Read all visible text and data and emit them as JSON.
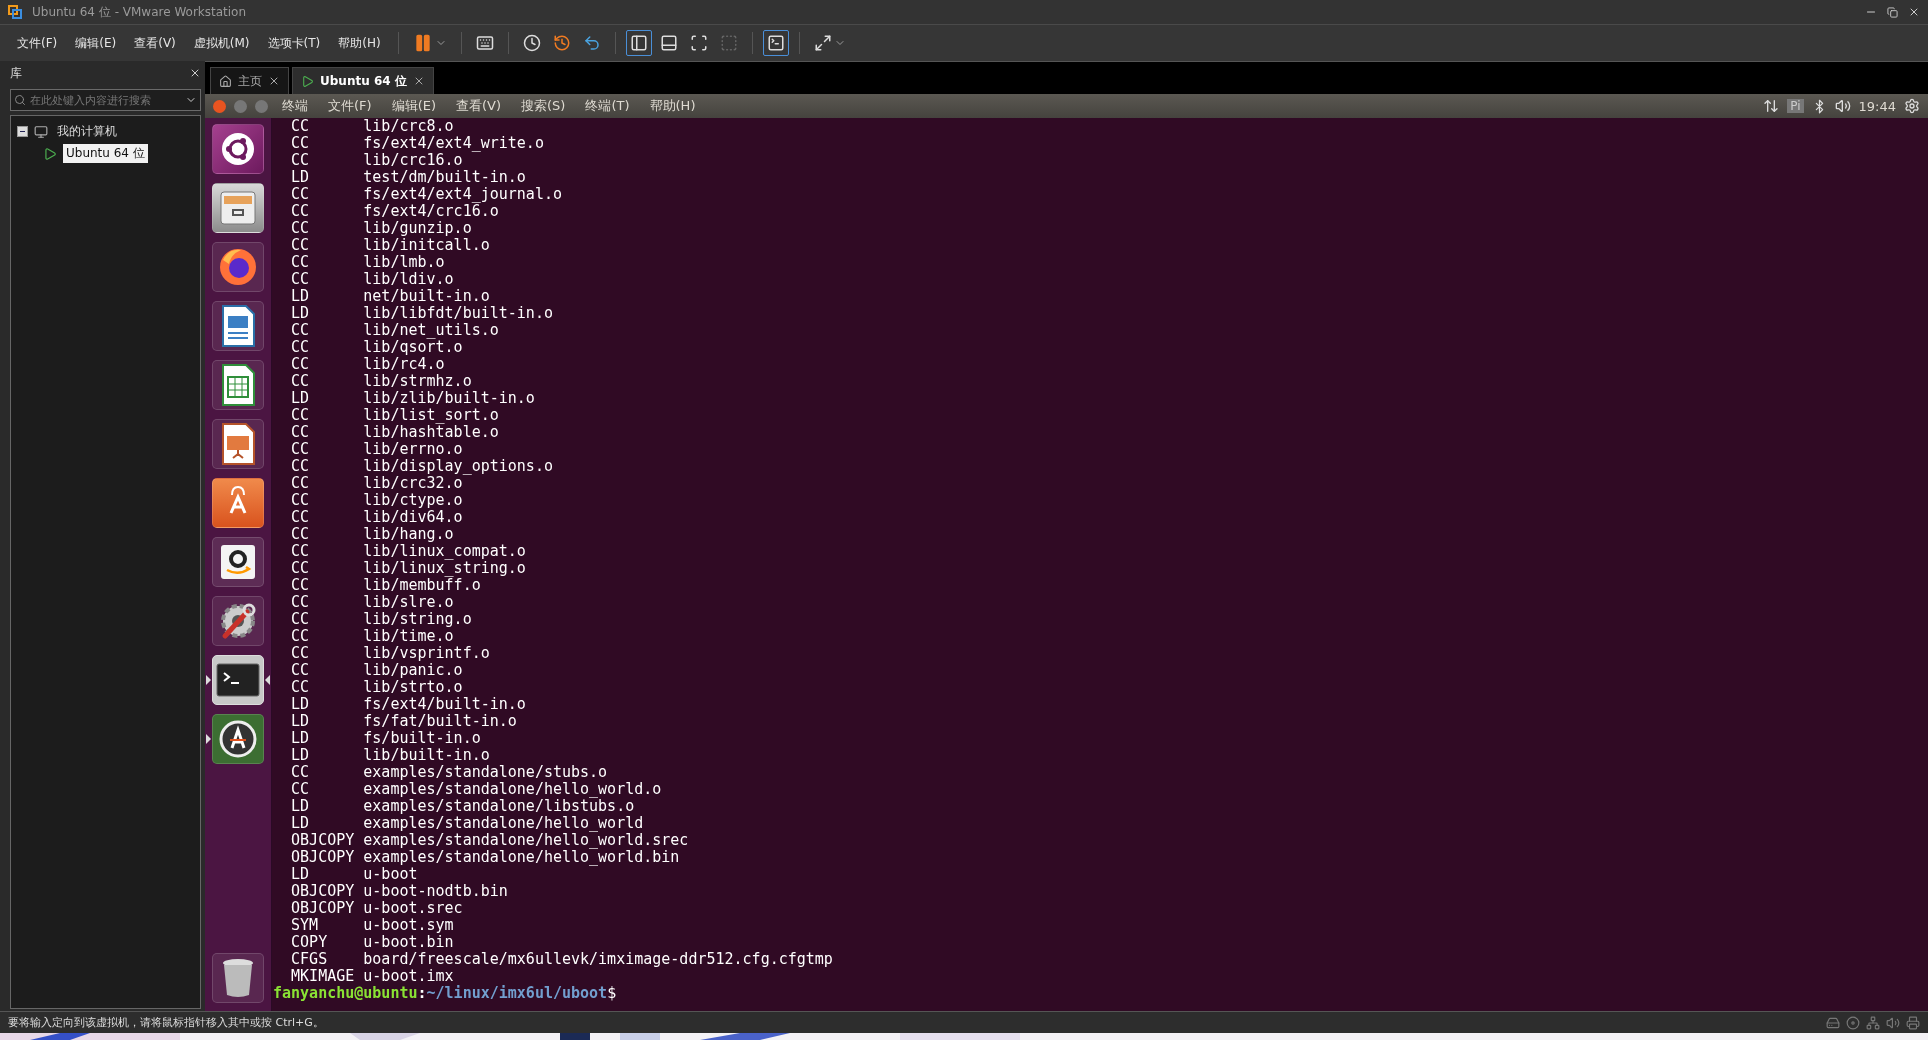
{
  "window": {
    "title": "Ubuntu 64 位 - VMware Workstation"
  },
  "menu": [
    "文件(F)",
    "编辑(E)",
    "查看(V)",
    "虚拟机(M)",
    "选项卡(T)",
    "帮助(H)"
  ],
  "library": {
    "title": "库",
    "search": {
      "placeholder": "在此处键入内容进行搜索"
    },
    "tree": [
      {
        "label": "我的计算机",
        "expanded": true,
        "children": [
          {
            "label": "Ubuntu 64 位",
            "selected": true
          }
        ]
      }
    ]
  },
  "tabs": [
    {
      "label": "主页",
      "kind": "home",
      "selected": false
    },
    {
      "label": "Ubuntu 64 位",
      "kind": "vm",
      "selected": true
    }
  ],
  "guest": {
    "menu": [
      "终端",
      "文件(F)",
      "编辑(E)",
      "查看(V)",
      "搜索(S)",
      "终端(T)",
      "帮助(H)"
    ],
    "keyboard": "Pi",
    "clock": "19:44",
    "launcher": [
      {
        "kind": "dash",
        "running": false,
        "focused": false
      },
      {
        "kind": "files",
        "running": false,
        "focused": false
      },
      {
        "kind": "browser",
        "running": false,
        "focused": false
      },
      {
        "kind": "writer",
        "running": false,
        "focused": false
      },
      {
        "kind": "calc",
        "running": false,
        "focused": false
      },
      {
        "kind": "impress",
        "running": false,
        "focused": false
      },
      {
        "kind": "software",
        "running": false,
        "focused": false
      },
      {
        "kind": "shop",
        "running": false,
        "focused": false
      },
      {
        "kind": "settings",
        "running": false,
        "focused": false
      },
      {
        "kind": "terminal",
        "running": true,
        "focused": true
      },
      {
        "kind": "updater",
        "running": true,
        "focused": false
      }
    ]
  },
  "terminal": {
    "lines": [
      "CC      lib/crc8.o",
      "CC      fs/ext4/ext4_write.o",
      "CC      lib/crc16.o",
      "LD      test/dm/built-in.o",
      "CC      fs/ext4/ext4_journal.o",
      "CC      fs/ext4/crc16.o",
      "CC      lib/gunzip.o",
      "CC      lib/initcall.o",
      "CC      lib/lmb.o",
      "CC      lib/ldiv.o",
      "LD      net/built-in.o",
      "LD      lib/libfdt/built-in.o",
      "CC      lib/net_utils.o",
      "CC      lib/qsort.o",
      "CC      lib/rc4.o",
      "CC      lib/strmhz.o",
      "LD      lib/zlib/built-in.o",
      "CC      lib/list_sort.o",
      "CC      lib/hashtable.o",
      "CC      lib/errno.o",
      "CC      lib/display_options.o",
      "CC      lib/crc32.o",
      "CC      lib/ctype.o",
      "CC      lib/div64.o",
      "CC      lib/hang.o",
      "CC      lib/linux_compat.o",
      "CC      lib/linux_string.o",
      "CC      lib/membuff.o",
      "CC      lib/slre.o",
      "CC      lib/string.o",
      "CC      lib/time.o",
      "CC      lib/vsprintf.o",
      "CC      lib/panic.o",
      "CC      lib/strto.o",
      "LD      fs/ext4/built-in.o",
      "LD      fs/fat/built-in.o",
      "LD      fs/built-in.o",
      "LD      lib/built-in.o",
      "CC      examples/standalone/stubs.o",
      "CC      examples/standalone/hello_world.o",
      "LD      examples/standalone/libstubs.o",
      "LD      examples/standalone/hello_world",
      "OBJCOPY examples/standalone/hello_world.srec",
      "OBJCOPY examples/standalone/hello_world.bin",
      "LD      u-boot",
      "OBJCOPY u-boot-nodtb.bin",
      "OBJCOPY u-boot.srec",
      "SYM     u-boot.sym",
      "COPY    u-boot.bin",
      "CFGS    board/freescale/mx6ullevk/imximage-ddr512.cfg.cfgtmp",
      "MKIMAGE u-boot.imx"
    ],
    "prompt": {
      "user": "fanyanchu@ubuntu",
      "sep": ":",
      "path": "~/linux/imx6ul/uboot",
      "symbol": "$"
    }
  },
  "status_bar": {
    "text": "要将输入定向到该虚拟机，请将鼠标指针移入其中或按 Ctrl+G。"
  }
}
